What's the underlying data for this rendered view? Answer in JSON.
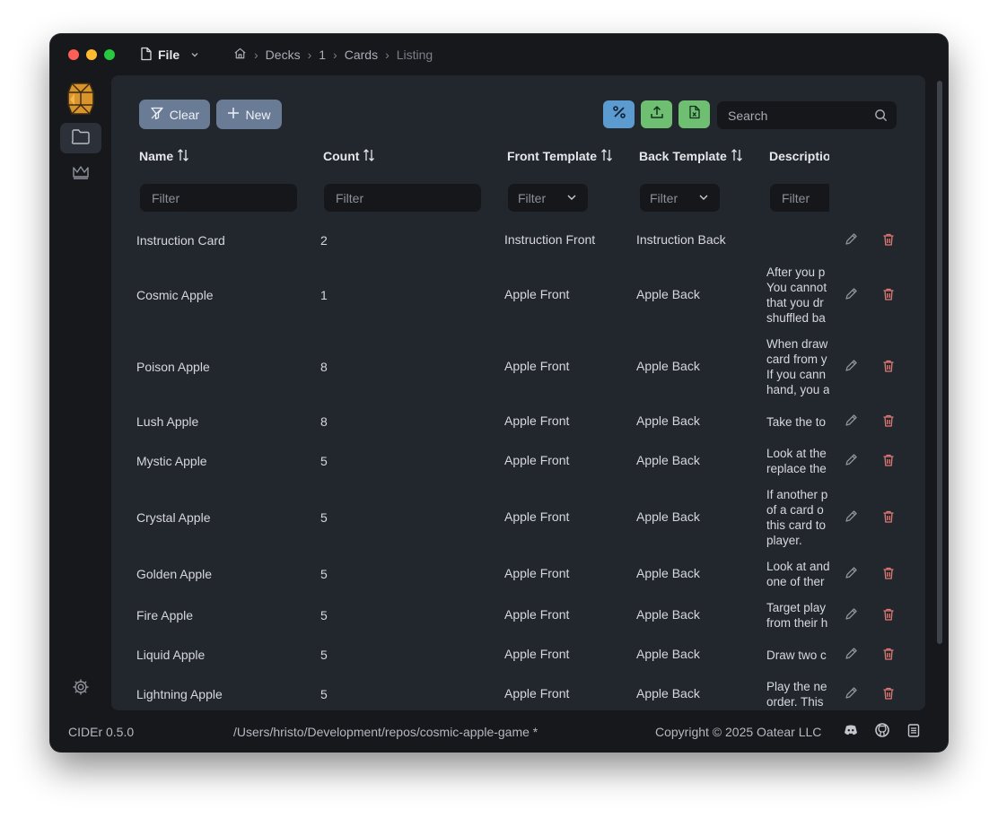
{
  "menu": {
    "file_label": "File"
  },
  "breadcrumb": [
    "Decks",
    "1",
    "Cards",
    "Listing"
  ],
  "toolbar": {
    "clear_label": "Clear",
    "new_label": "New",
    "search_placeholder": "Search",
    "accent_colors": {
      "percent": "#5b9bd0",
      "export": "#6fbf73",
      "excel": "#6fbf73"
    }
  },
  "table": {
    "columns": [
      "Name",
      "Count",
      "Front Template",
      "Back Template",
      "Descriptio"
    ],
    "filter_placeholder": "Filter",
    "rows": [
      {
        "name": "Instruction Card",
        "count": "2",
        "front": "Instruction Front",
        "back": "Instruction Back",
        "desc": ""
      },
      {
        "name": "Cosmic Apple",
        "count": "1",
        "front": "Apple Front",
        "back": "Apple Back",
        "desc": "After you p\nYou cannot\nthat you dr\nshuffled ba"
      },
      {
        "name": "Poison Apple",
        "count": "8",
        "front": "Apple Front",
        "back": "Apple Back",
        "desc": "When draw\ncard from y\nIf you cann\nhand, you a"
      },
      {
        "name": "Lush Apple",
        "count": "8",
        "front": "Apple Front",
        "back": "Apple Back",
        "desc": "Take the to"
      },
      {
        "name": "Mystic Apple",
        "count": "5",
        "front": "Apple Front",
        "back": "Apple Back",
        "desc": "Look at the\nreplace the"
      },
      {
        "name": "Crystal Apple",
        "count": "5",
        "front": "Apple Front",
        "back": "Apple Back",
        "desc": "If another p\nof a card o\nthis card to\nplayer."
      },
      {
        "name": "Golden Apple",
        "count": "5",
        "front": "Apple Front",
        "back": "Apple Back",
        "desc": "Look at and\none of ther"
      },
      {
        "name": "Fire Apple",
        "count": "5",
        "front": "Apple Front",
        "back": "Apple Back",
        "desc": "Target play\nfrom their h"
      },
      {
        "name": "Liquid Apple",
        "count": "5",
        "front": "Apple Front",
        "back": "Apple Back",
        "desc": "Draw two c"
      },
      {
        "name": "Lightning Apple",
        "count": "5",
        "front": "Apple Front",
        "back": "Apple Back",
        "desc": "Play the ne\norder. This"
      }
    ]
  },
  "statusbar": {
    "version": "CIDEr 0.5.0",
    "path": "/Users/hristo/Development/repos/cosmic-apple-game *",
    "copyright": "Copyright © 2025 Oatear LLC"
  }
}
